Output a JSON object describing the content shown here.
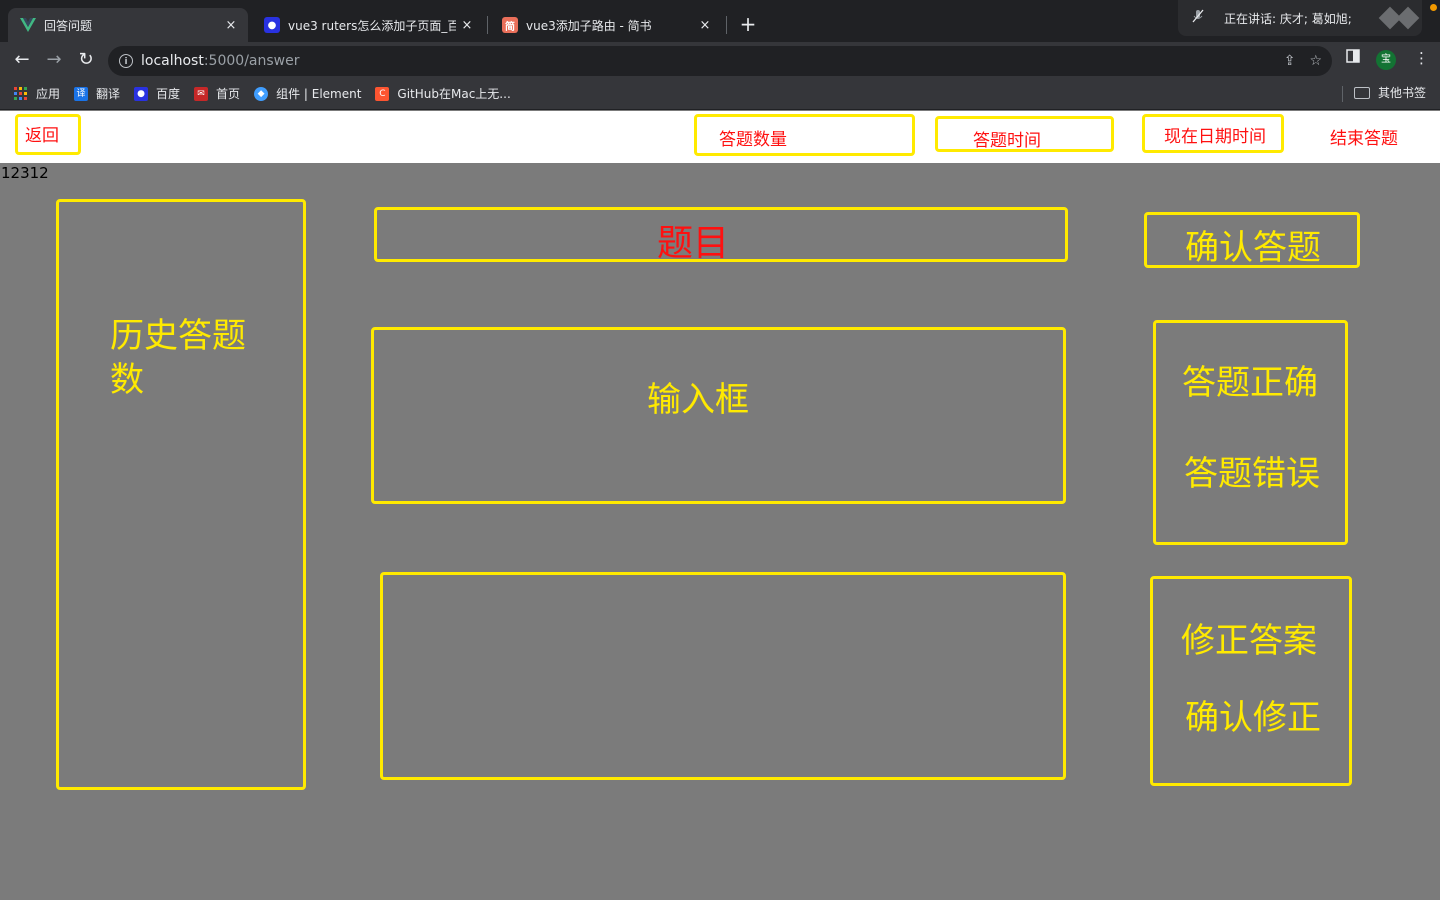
{
  "browser": {
    "tabs": [
      {
        "title": "回答问题",
        "favicon": "vue-logo-icon",
        "active": true
      },
      {
        "title": "vue3 ruters怎么添加子页面_百度",
        "favicon": "baidu-paw-icon",
        "active": false
      },
      {
        "title": "vue3添加子路由 - 简书",
        "favicon": "jianshu-icon",
        "active": false
      }
    ],
    "close_glyph": "×",
    "new_tab_glyph": "+",
    "meeting_text": "正在讲话: 庆才; 葛如旭;",
    "address": {
      "host": "localhost",
      "path": ":5000/answer"
    },
    "profile_initial": "宝",
    "bookmarks": [
      {
        "label": "应用",
        "icon": "apps-grid-icon",
        "color": "#ea4335"
      },
      {
        "label": "翻译",
        "icon": "translate-icon",
        "color": "#1a73e8",
        "glyph": "译"
      },
      {
        "label": "百度",
        "icon": "baidu-paw-icon",
        "color": "#2932e1"
      },
      {
        "label": "首页",
        "icon": "site-icon",
        "color": "#c62828"
      },
      {
        "label": "组件 | Element",
        "icon": "element-icon",
        "color": "#409eff"
      },
      {
        "label": "GitHub在Mac上无...",
        "icon": "csdn-icon",
        "color": "#fc5531",
        "glyph": "C"
      }
    ],
    "other_bookmarks": "其他书签"
  },
  "page": {
    "header": {
      "back": "返回",
      "question_count": "答题数量",
      "answer_time": "答题时间",
      "current_datetime": "现在日期时间",
      "end_answering": "结束答题"
    },
    "body_text": "12312",
    "history_count": "历史答题数",
    "question": "题目",
    "confirm_answer": "确认答题",
    "input_box": "输入框",
    "answer_correct": "答题正确",
    "answer_wrong": "答题错误",
    "fix_answer": "修正答案",
    "confirm_fix": "确认修正"
  }
}
